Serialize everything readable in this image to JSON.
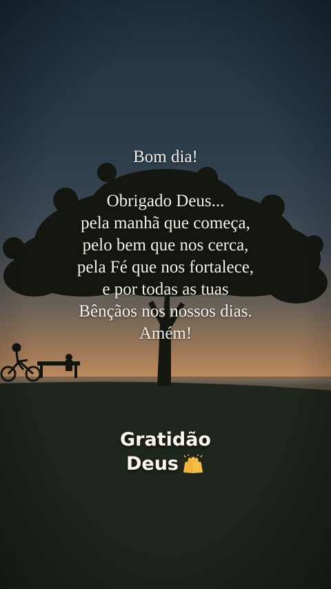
{
  "quote": {
    "greeting": "Bom dia!",
    "lines": [
      "Obrigado Deus...",
      "pela manhã que começa,",
      "pelo bem que nos cerca,",
      "pela Fé que nos fortalece,",
      "e por todas as tuas",
      "Bênçãos nos nossos dias.",
      "Amém!"
    ]
  },
  "footer": {
    "line1": "Gratidão",
    "line2": "Deus",
    "emoji": "raising-hands-icon"
  },
  "colors": {
    "sky_top": "#233847",
    "sky_mid": "#3e4a55",
    "horizon": "#b4865d",
    "ground": "#1e241c",
    "text": "#f4f1ea"
  }
}
